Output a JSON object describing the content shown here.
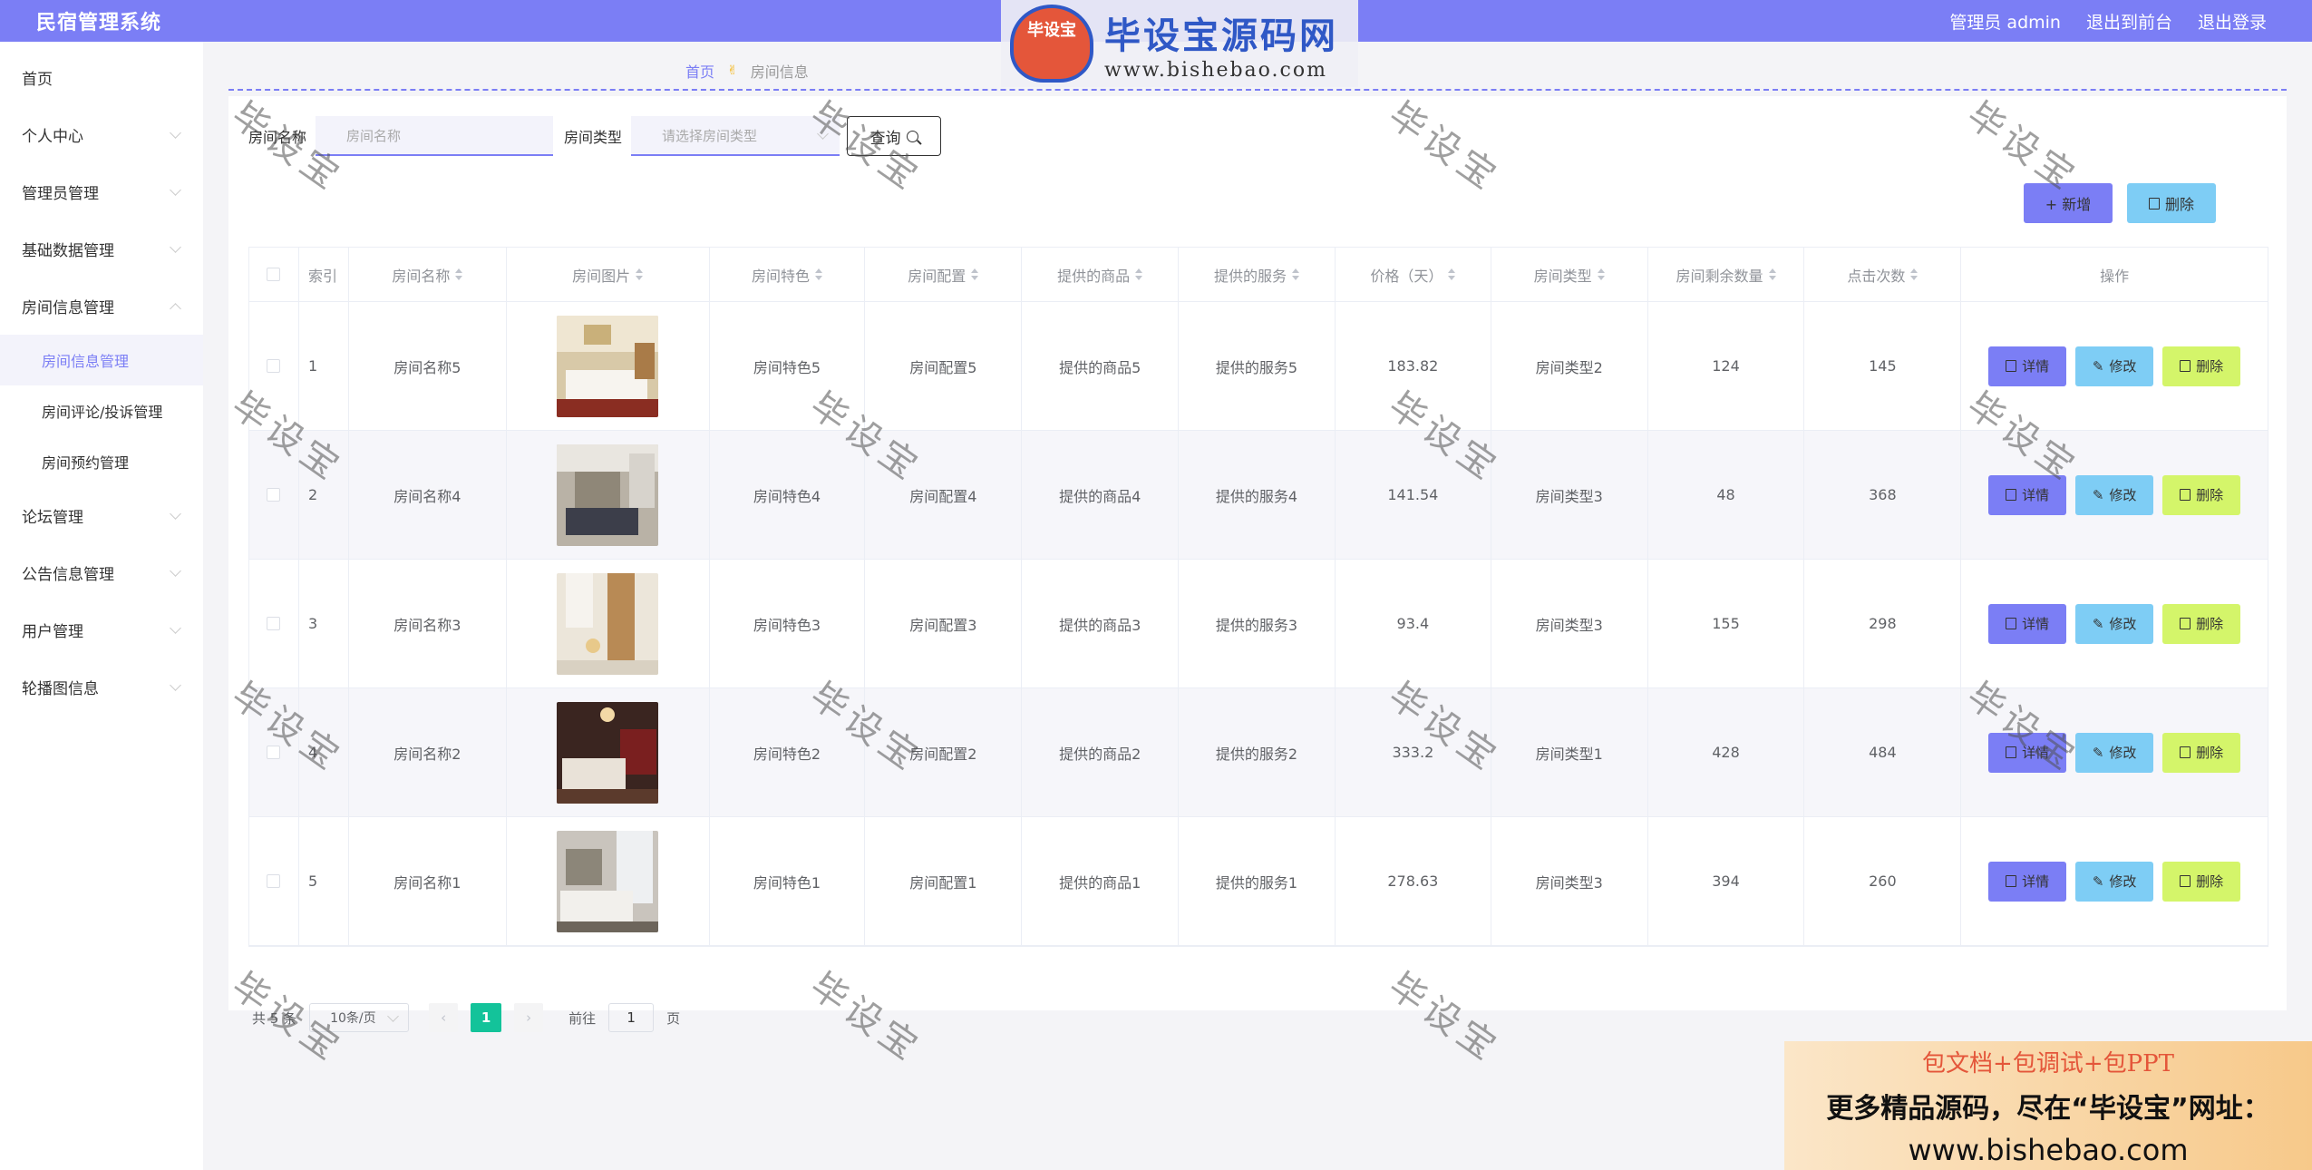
{
  "app": {
    "title": "民宿管理系统"
  },
  "topbar": {
    "user": "管理员 admin",
    "to_front": "退出到前台",
    "logout": "退出登录"
  },
  "sidebar": {
    "items": [
      {
        "label": "首页"
      },
      {
        "label": "个人中心"
      },
      {
        "label": "管理员管理"
      },
      {
        "label": "基础数据管理"
      },
      {
        "label": "房间信息管理"
      },
      {
        "label": "房间信息管理"
      },
      {
        "label": "房间评论/投诉管理"
      },
      {
        "label": "房间预约管理"
      },
      {
        "label": "论坛管理"
      },
      {
        "label": "公告信息管理"
      },
      {
        "label": "用户管理"
      },
      {
        "label": "轮播图信息"
      }
    ]
  },
  "breadcrumb": {
    "home": "首页",
    "sep": "✌",
    "current": "房间信息"
  },
  "search": {
    "name_label": "房间名称",
    "name_placeholder": "房间名称",
    "type_label": "房间类型",
    "type_placeholder": "请选择房间类型",
    "query_label": "查询"
  },
  "actions": {
    "add_label": "+ 新增",
    "delete_label": "删除"
  },
  "table": {
    "headers": [
      "索引",
      "房间名称",
      "房间图片",
      "房间特色",
      "房间配置",
      "提供的商品",
      "提供的服务",
      "价格（天）",
      "房间类型",
      "房间剩余数量",
      "点击次数",
      "操作"
    ],
    "rows": [
      {
        "idx": "1",
        "name": "房间名称5",
        "feature": "房间特色5",
        "config": "房间配置5",
        "goods": "提供的商品5",
        "service": "提供的服务5",
        "price": "183.82",
        "type": "房间类型2",
        "remain": "124",
        "clicks": "145"
      },
      {
        "idx": "2",
        "name": "房间名称4",
        "feature": "房间特色4",
        "config": "房间配置4",
        "goods": "提供的商品4",
        "service": "提供的服务4",
        "price": "141.54",
        "type": "房间类型3",
        "remain": "48",
        "clicks": "368"
      },
      {
        "idx": "3",
        "name": "房间名称3",
        "feature": "房间特色3",
        "config": "房间配置3",
        "goods": "提供的商品3",
        "service": "提供的服务3",
        "price": "93.4",
        "type": "房间类型3",
        "remain": "155",
        "clicks": "298"
      },
      {
        "idx": "4",
        "name": "房间名称2",
        "feature": "房间特色2",
        "config": "房间配置2",
        "goods": "提供的商品2",
        "service": "提供的服务2",
        "price": "333.2",
        "type": "房间类型1",
        "remain": "428",
        "clicks": "484"
      },
      {
        "idx": "5",
        "name": "房间名称1",
        "feature": "房间特色1",
        "config": "房间配置1",
        "goods": "提供的商品1",
        "service": "提供的服务1",
        "price": "278.63",
        "type": "房间类型3",
        "remain": "394",
        "clicks": "260"
      }
    ],
    "op_detail": "详情",
    "op_edit": "修改",
    "op_delete": "删除"
  },
  "pager": {
    "total": "共 5 条",
    "size": "10条/页",
    "current": "1",
    "goto": "前往",
    "goto_value": "1",
    "page_unit": "页"
  },
  "watermark": {
    "badge": "毕设宝",
    "title": "毕设宝源码网",
    "url": "www.bishebao.com",
    "stamp": "毕设宝"
  },
  "ad": {
    "line1": "包文档+包调试+包PPT",
    "line2": "更多精品源码，尽在“毕设宝”网址：",
    "line3": "www.bishebao.com"
  },
  "colors": {
    "accent": "#7b7ef5",
    "info": "#7ecdf5",
    "lime": "#d4f56a",
    "page_active": "#13c39a"
  }
}
